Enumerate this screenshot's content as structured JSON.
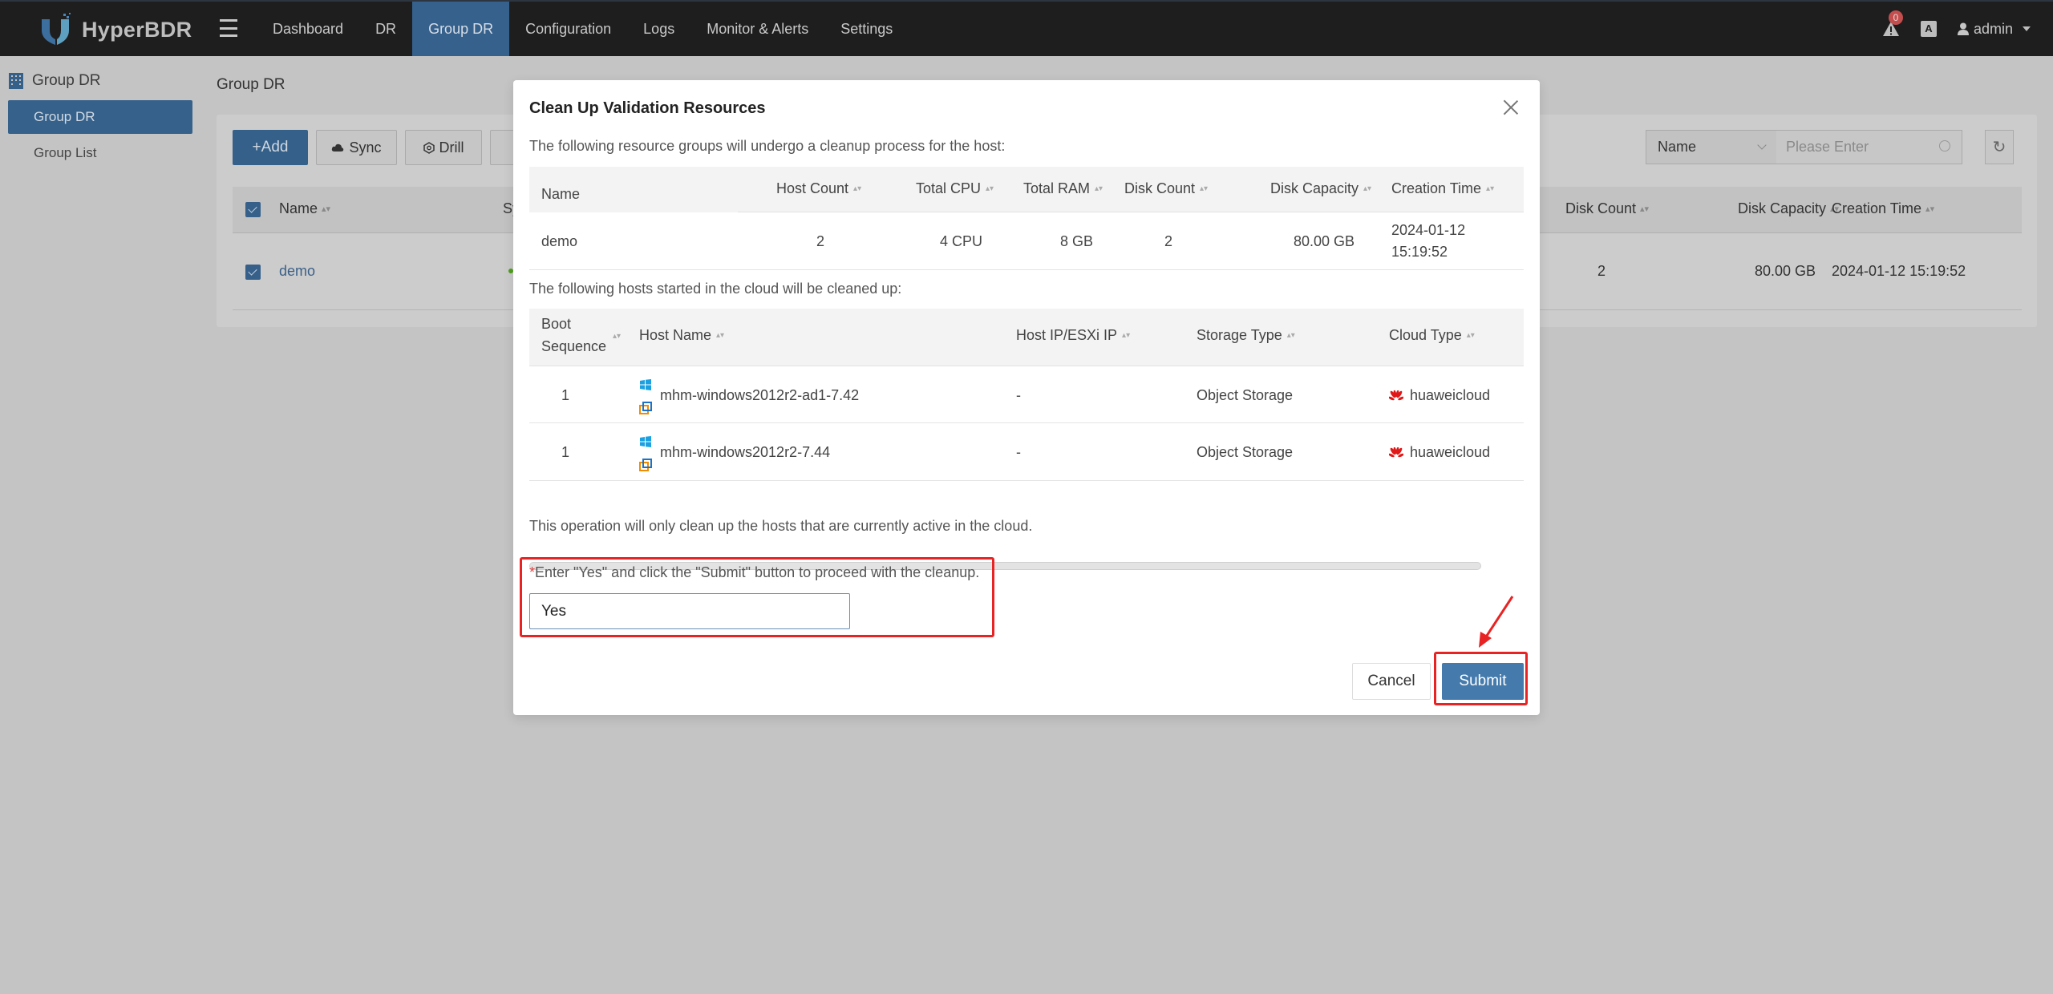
{
  "app": {
    "name": "HyperBDR",
    "brand_color": "#36618c",
    "nav": [
      {
        "label": "Dashboard",
        "active": false
      },
      {
        "label": "DR",
        "active": false
      },
      {
        "label": "Group DR",
        "active": true
      },
      {
        "label": "Configuration",
        "active": false
      },
      {
        "label": "Logs",
        "active": false
      },
      {
        "label": "Monitor & Alerts",
        "active": false
      },
      {
        "label": "Settings",
        "active": false
      }
    ],
    "alert_count": "0",
    "lang_icon": "A",
    "user": "admin"
  },
  "sidebar": {
    "title": "Group DR",
    "items": [
      {
        "label": "Group DR",
        "active": true
      },
      {
        "label": "Group List",
        "active": false
      }
    ]
  },
  "page": {
    "title": "Group DR",
    "toolbar": {
      "add_label": "+Add",
      "sync_label": "Sync",
      "drill_label": "Drill"
    },
    "filter": {
      "field": "Name",
      "placeholder": "Please Enter"
    },
    "table": {
      "headers": {
        "name": "Name",
        "sync_partial": "Sy",
        "disk_count": "Disk Count",
        "disk_capacity": "Disk Capacity",
        "creation_time": "Creation Time"
      },
      "rows": [
        {
          "name": "demo",
          "disk_count": "2",
          "disk_capacity": "80.00 GB",
          "creation_time": "2024-01-12 15:19:52",
          "checked": true,
          "status_color": "#52c41a"
        }
      ]
    }
  },
  "modal": {
    "title": "Clean Up Validation Resources",
    "groups_intro": "The following resource groups will undergo a cleanup process for the host:",
    "groups_table": {
      "headers": [
        "Name",
        "Host Count",
        "Total CPU",
        "Total RAM",
        "Disk Count",
        "Disk Capacity",
        "Creation Time"
      ],
      "rows": [
        {
          "name": "demo",
          "host_count": "2",
          "total_cpu": "4 CPU",
          "total_ram": "8 GB",
          "disk_count": "2",
          "disk_capacity": "80.00 GB",
          "creation_date": "2024-01-12",
          "creation_clock": "15:19:52"
        }
      ]
    },
    "hosts_intro": "The following hosts started in the cloud will be cleaned up:",
    "hosts_table": {
      "headers": {
        "boot_line1": "Boot",
        "boot_line2": "Sequence",
        "host_name": "Host Name",
        "host_ip": "Host IP/ESXi IP",
        "storage_type": "Storage Type",
        "cloud_type": "Cloud Type"
      },
      "rows": [
        {
          "boot": "1",
          "host_name": "mhm-windows2012r2-ad1-7.42",
          "host_ip": "-",
          "storage_type": "Object Storage",
          "cloud_type": "huaweicloud",
          "os_icon": "windows-icon",
          "platform_icon": "vmware-icon",
          "cloud_icon": "huawei-icon"
        },
        {
          "boot": "1",
          "host_name": "mhm-windows2012r2-7.44",
          "host_ip": "-",
          "storage_type": "Object Storage",
          "cloud_type": "huaweicloud",
          "os_icon": "windows-icon",
          "platform_icon": "vmware-icon",
          "cloud_icon": "huawei-icon"
        }
      ]
    },
    "note": "This operation will only clean up the hosts that are currently active in the cloud.",
    "confirm_label_star": "*",
    "confirm_label": "Enter \"Yes\" and click the \"Submit\" button to proceed with the cleanup.",
    "confirm_value": "Yes",
    "cancel_label": "Cancel",
    "submit_label": "Submit",
    "submit_color": "#457aad",
    "annotation_color": "#e82323"
  }
}
